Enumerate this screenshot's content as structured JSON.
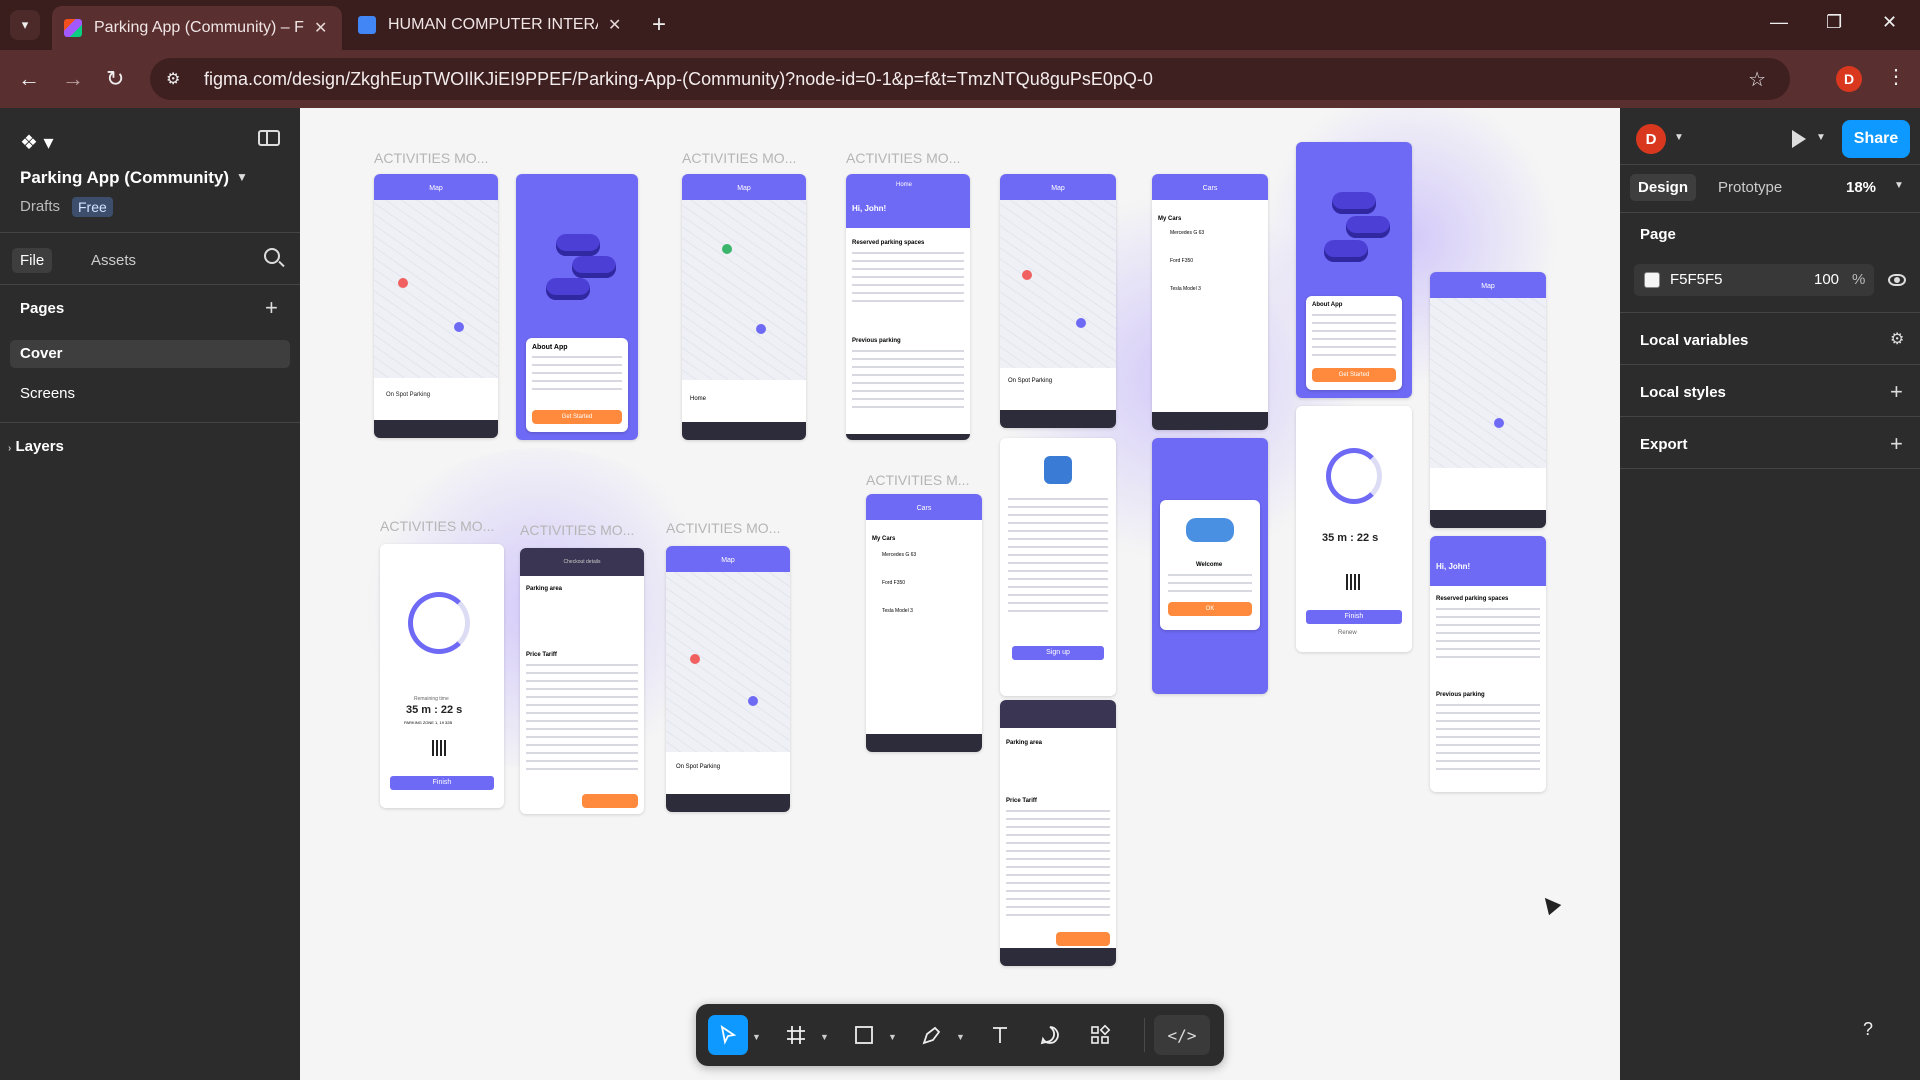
{
  "browser": {
    "tabs": [
      {
        "title": "Parking App (Community) – Figma",
        "active": true
      },
      {
        "title": "HUMAN COMPUTER INTERACTION",
        "active": false
      }
    ],
    "url": "figma.com/design/ZkghEupTWOIlKJiEI9PPEF/Parking-App-(Community)?node-id=0-1&p=f&t=TmzNTQu8guPsE0pQ-0",
    "profile_initial": "D"
  },
  "file": {
    "title": "Parking App (Community)",
    "drafts": "Drafts",
    "plan": "Free"
  },
  "left_panel": {
    "tabs": [
      "File",
      "Assets"
    ],
    "pages_heading": "Pages",
    "pages": [
      "Cover",
      "Screens"
    ],
    "selected_page": "Cover",
    "layers_heading": "Layers"
  },
  "right_panel": {
    "avatar": "D",
    "share": "Share",
    "tabs": [
      "Design",
      "Prototype"
    ],
    "zoom": "18%",
    "page_section": "Page",
    "page_color": "F5F5F5",
    "page_color_hex": "#F5F5F5",
    "opacity": "100",
    "opacity_unit": "%",
    "local_variables": "Local variables",
    "local_styles": "Local styles",
    "export": "Export"
  },
  "canvas": {
    "frame_labels": [
      "ACTIVITIES MO...",
      "ACTIVITIES MO...",
      "ACTIVITIES MO...",
      "ACTIVITIES M...",
      "ACTIVITIES MO...",
      "ACTIVITIES MO...",
      "ACTIVITIES MO..."
    ],
    "texts": {
      "about_app": "About App",
      "get_started": "Get Started",
      "hi_john": "Hi, John!",
      "home": "Home",
      "map": "Map",
      "cars": "Cars",
      "my_cars": "My Cars",
      "welcome": "Welcome",
      "ok": "OK",
      "finish": "Finish",
      "renew": "Renew",
      "timer": "35 m : 22 s",
      "remaining": "Remaining time",
      "zone": "PARKING ZONE 1, 19 32B",
      "sign_up": "Sign up",
      "parking_area": "Parking area",
      "price_tariff": "Price Tariff",
      "on_spot": "On Spot Parking",
      "mercedes": "Mercedes G 63",
      "ford": "Ford F350",
      "tesla": "Tesla Model 3",
      "reserved": "Reserved parking spaces",
      "previous": "Previous parking",
      "checkout": "Checkout details"
    }
  },
  "toolbar": {
    "tools": [
      "move-tool",
      "frame-tool",
      "shape-tool",
      "pen-tool",
      "text-tool",
      "comment-tool",
      "actions-tool"
    ],
    "dev_mode": "</>"
  },
  "help": "?",
  "colors": {
    "accent": "#0d99ff",
    "app_purple": "#6f6af5",
    "app_orange": "#ff8a3d",
    "profile": "#d9381e"
  }
}
